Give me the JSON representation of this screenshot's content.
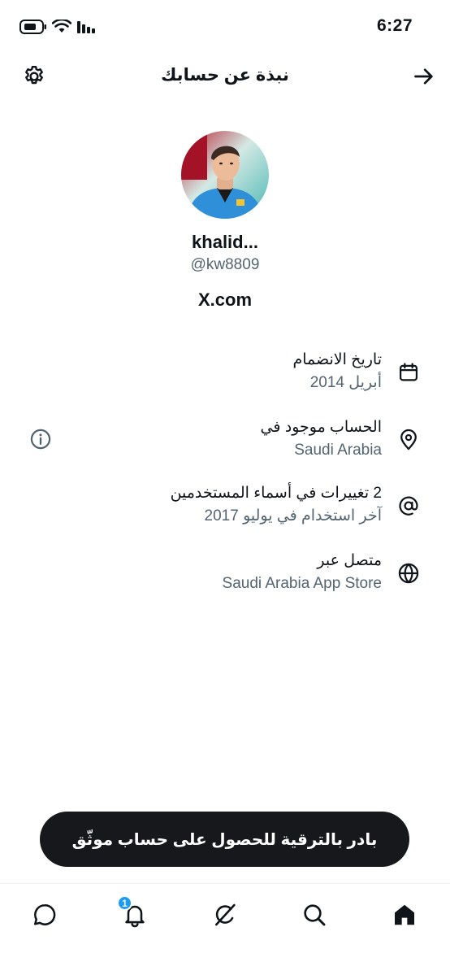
{
  "status_bar": {
    "time": "6:27"
  },
  "header": {
    "title": "نبذة عن حسابك"
  },
  "profile": {
    "display_name": "khalid...",
    "handle": "@kw8809",
    "site": "X.com"
  },
  "info_rows": [
    {
      "title": "تاريخ الانضمام",
      "value": "أبريل 2014",
      "icon": "calendar-icon"
    },
    {
      "title": "الحساب موجود في",
      "value": "Saudi Arabia",
      "icon": "location-pin-icon"
    },
    {
      "title": "2 تغييرات في أسماء المستخدمين",
      "value": "آخر استخدام في يوليو 2017",
      "icon": "at-icon"
    },
    {
      "title": "متصل عبر",
      "value": "Saudi Arabia App Store",
      "icon": "globe-icon"
    }
  ],
  "upgrade_button": {
    "label": "بادر بالترقية للحصول على حساب موثّق"
  },
  "tab_bar": {
    "notification_badge": "1",
    "tabs": [
      "messages-icon",
      "notifications-icon",
      "grok-icon",
      "search-icon",
      "home-icon"
    ]
  },
  "colors": {
    "primary_text": "#0f1419",
    "secondary_text": "#536471",
    "accent": "#1d9bf0",
    "button_bg": "#16181c"
  }
}
